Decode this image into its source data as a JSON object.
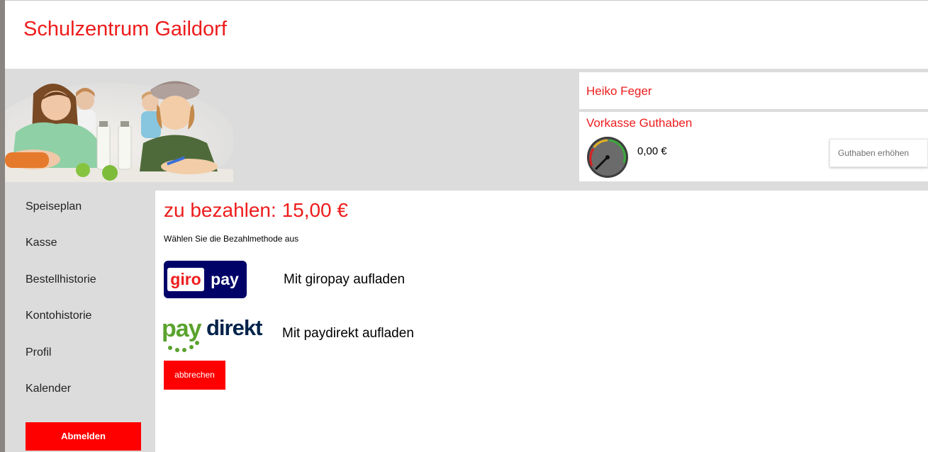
{
  "header": {
    "site_title": "Schulzentrum Gaildorf"
  },
  "user": {
    "name": "Heiko Feger"
  },
  "balance": {
    "title": "Vorkasse Guthaben",
    "amount": "0,00 €",
    "topup_label": "Guthaben erhöhen",
    "gauge_icon": "gauge-icon"
  },
  "nav": {
    "items": [
      {
        "label": "Speiseplan"
      },
      {
        "label": "Kasse"
      },
      {
        "label": "Bestellhistorie"
      },
      {
        "label": "Kontohistorie"
      },
      {
        "label": "Profil"
      },
      {
        "label": "Kalender"
      }
    ],
    "logout_label": "Abmelden"
  },
  "payment": {
    "amount_title": "zu bezahlen: 15,00 €",
    "hint": "Wählen Sie die Bezahlmethode aus",
    "methods": [
      {
        "logo_text_a": "giro",
        "logo_text_b": "pay",
        "label": "Mit giropay aufladen"
      },
      {
        "logo_text_a": "pay",
        "logo_text_b": "direkt",
        "label": "Mit paydirekt aufladen"
      }
    ],
    "cancel_label": "abbrechen"
  },
  "colors": {
    "brand_red": "#ee1c1c",
    "button_red": "#ff0000",
    "panel_gray": "#dcdcdc",
    "giropay_navy": "#000268",
    "paydirekt_green": "#5aa22d",
    "paydirekt_navy": "#00234a"
  }
}
